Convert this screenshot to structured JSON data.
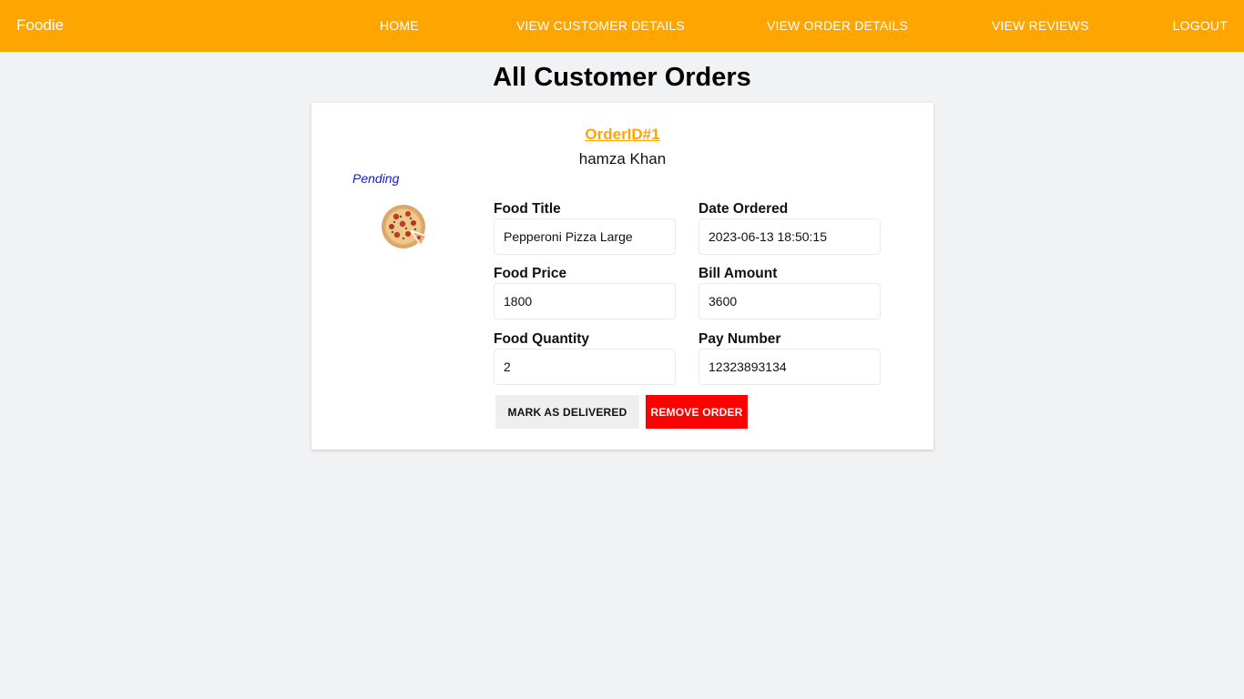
{
  "navbar": {
    "brand": "Foodie",
    "links": [
      "HOME",
      "VIEW CUSTOMER DETAILS",
      "VIEW ORDER DETAILS",
      "VIEW REVIEWS",
      "LOGOUT"
    ],
    "color": "#ffa500"
  },
  "page": {
    "title": "All Customer Orders"
  },
  "order": {
    "id_label": "OrderID#1",
    "customer_name": "hamza Khan",
    "status": "Pending",
    "image_icon": "pepperoni-pizza-image",
    "fields": {
      "food_title": {
        "label": "Food Title",
        "value": "Pepperoni Pizza Large"
      },
      "date_ordered": {
        "label": "Date Ordered",
        "value": "2023-06-13 18:50:15"
      },
      "food_price": {
        "label": "Food Price",
        "value": "1800"
      },
      "bill_amount": {
        "label": "Bill Amount",
        "value": "3600"
      },
      "food_quantity": {
        "label": "Food Quantity",
        "value": "2"
      },
      "pay_number": {
        "label": "Pay Number",
        "value": "12323893134"
      }
    },
    "buttons": {
      "mark_delivered": "MARK AS DELIVERED",
      "remove": "REMOVE ORDER"
    },
    "colors": {
      "id_link": "#ffa500",
      "status": "#1a18c8",
      "remove_button": "#ff0000"
    }
  }
}
